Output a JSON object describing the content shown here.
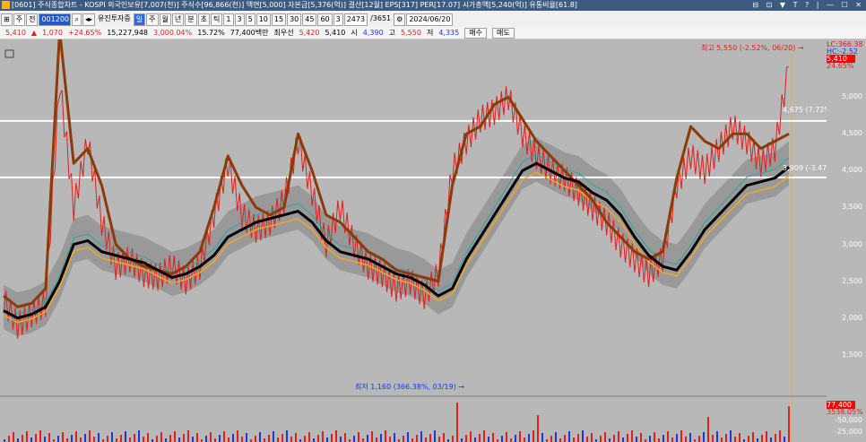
{
  "window": {
    "title": "[0601] 주식종합차트 - KOSPI  외국인보유[7,007(천)]  주식수[96,866(천)]  액면[5,000]  자본금[5,376(억)]  결산[12월]  EPS[317]  PER[17.07]  시가총액[5,240(억)]  유통비율[61.8]",
    "controls": "⊟ ⊡ ▼ T ? | — ☐ ✕"
  },
  "toolbar": {
    "type_select": "주",
    "all_label": "전",
    "code": "001200",
    "name": "유진투자증",
    "periods": [
      "일",
      "주",
      "월",
      "년",
      "분",
      "초",
      "틱"
    ],
    "active_period": "일",
    "intervals": [
      "1",
      "3",
      "5",
      "10",
      "15",
      "30",
      "45",
      "60"
    ],
    "interval_value": "3",
    "count": "2473",
    "total": "/3651",
    "date": "2024/06/20"
  },
  "quote": {
    "price": "5,410",
    "change": "1,070",
    "change_pct": "+24.65%",
    "volume": "15,227,948",
    "vol_ratio": "3,000.04%",
    "turnover": "15.72%",
    "amount": "77,400백만",
    "best_bid_label": "최우선",
    "ask": "5,420",
    "bid": "5,410",
    "open_label": "시",
    "open": "4,390",
    "high_label": "고",
    "high": "5,550",
    "low_label": "저",
    "low": "4,335",
    "buy_label": "매수",
    "sell_label": "매도"
  },
  "colors": {
    "background": "#b8b8b8",
    "candle": "#e0201c",
    "ma_brown": "#8b3a0a",
    "ma_black": "#000000",
    "ma_orange": "#f5a623",
    "ma_teal": "#2aa6a6",
    "cloud": "#808080",
    "price_box": "#ff0000"
  },
  "chart_annotations": {
    "high_marker": "최고 5,550 (-2.52%, 06/20) →",
    "low_marker": "최저 1,160 (366.38%, 03/19) →",
    "line_upper_label": "4,675 (7.72%)",
    "line_lower_label": "3,909 (-3.47%)"
  },
  "right_panel": {
    "lc": "LC:366.38",
    "hc": "HC:-2.52",
    "price_box": "5,410",
    "pct_box": "24.65%",
    "volume_box": "77,400",
    "volume_pct": "3538.05%"
  },
  "chart_data": {
    "type": "line",
    "title": "",
    "ylim": [
      1160,
      5900
    ],
    "y_ticks": [
      "5,000",
      "4,500",
      "4,000",
      "3,500",
      "3,000",
      "2,500",
      "2,000",
      "1,500"
    ],
    "horizontal_lines": [
      4675,
      3909
    ],
    "series": [
      {
        "values": [
          2250,
          1900,
          2050,
          2200,
          5200,
          3500,
          4400,
          3300,
          2700,
          2800,
          2600,
          2550,
          2700,
          2500,
          2700,
          3400,
          4100,
          3400,
          3200,
          3300,
          3600,
          4400,
          3700,
          3000,
          3500,
          3000,
          2700,
          2600,
          2400,
          2500,
          2300,
          2600,
          4000,
          4400,
          4700,
          4800,
          5000,
          4500,
          4200,
          4000,
          3900,
          3700,
          3500,
          3300,
          3000,
          2800,
          2600,
          2800,
          3800,
          4200,
          4000,
          4300,
          4600,
          4400,
          4100,
          4300,
          5410
        ]
      },
      {
        "values": [
          2100,
          2000,
          2050,
          2150,
          2500,
          3000,
          3050,
          2900,
          2850,
          2800,
          2750,
          2650,
          2550,
          2600,
          2700,
          2850,
          3100,
          3200,
          3300,
          3350,
          3400,
          3450,
          3300,
          3050,
          2900,
          2850,
          2800,
          2700,
          2600,
          2550,
          2450,
          2300,
          2400,
          2800,
          3100,
          3400,
          3700,
          4000,
          4100,
          4000,
          3900,
          3850,
          3700,
          3600,
          3400,
          3100,
          2850,
          2700,
          2650,
          2900,
          3200,
          3400,
          3600,
          3800,
          3850,
          3900,
          4050
        ]
      },
      {
        "values": [
          2300,
          2150,
          2200,
          2400,
          5900,
          4100,
          4300,
          3800,
          3000,
          2800,
          2700,
          2650,
          2600,
          2700,
          2900,
          3500,
          4200,
          3800,
          3500,
          3400,
          3500,
          4500,
          4000,
          3400,
          3300,
          3100,
          2900,
          2800,
          2650,
          2600,
          2550,
          2500,
          3800,
          4500,
          4600,
          4900,
          5000,
          4700,
          4400,
          4200,
          4000,
          3800,
          3600,
          3300,
          3100,
          2900,
          2800,
          2900,
          3900,
          4600,
          4400,
          4300,
          4500,
          4500,
          4300,
          4400,
          4500
        ]
      }
    ]
  }
}
